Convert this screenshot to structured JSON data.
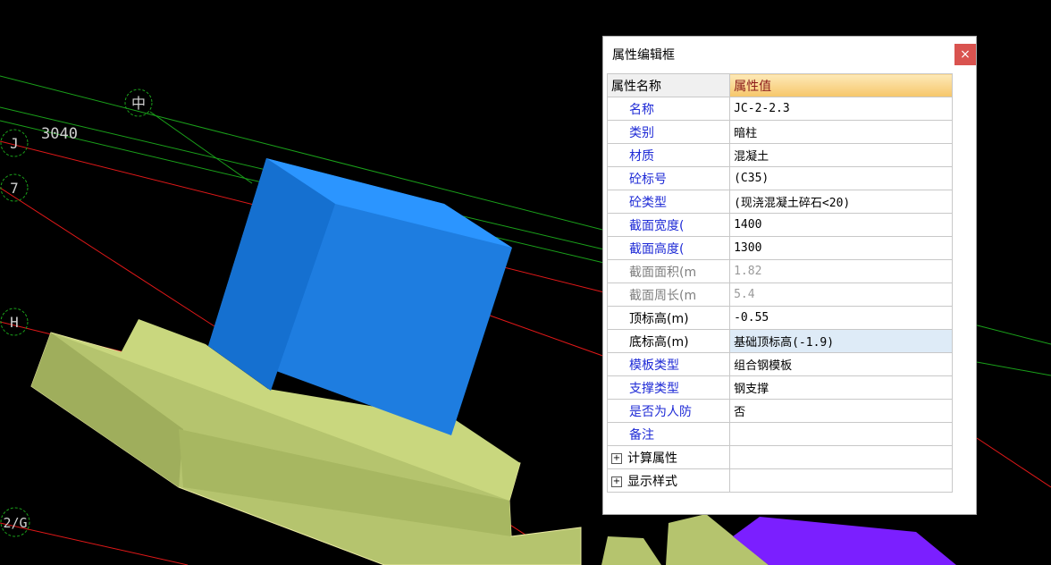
{
  "viewport": {
    "axis_labels": {
      "zhong": "中",
      "j": "J",
      "seven": "7",
      "h": "H",
      "two_g": "2/G"
    },
    "dimension_text": "3040",
    "colors": {
      "background": "#000000",
      "column": "#1e7de0",
      "foundation": "#b5c46e",
      "purple_element": "#7b1fff"
    }
  },
  "panel": {
    "title": "属性编辑框",
    "close_label": "×",
    "header": {
      "name": "属性名称",
      "value": "属性值"
    },
    "rows": [
      {
        "name": "名称",
        "value": "JC-2-2.3"
      },
      {
        "name": "类别",
        "value": "暗柱"
      },
      {
        "name": "材质",
        "value": "混凝土"
      },
      {
        "name": "砼标号",
        "value": "(C35)"
      },
      {
        "name": "砼类型",
        "value": "(现浇混凝土碎石<20)"
      },
      {
        "name": "截面宽度(",
        "value": "1400"
      },
      {
        "name": "截面高度(",
        "value": "1300"
      },
      {
        "name": "截面面积(m",
        "value": "1.82"
      },
      {
        "name": "截面周长(m",
        "value": "5.4"
      },
      {
        "name": "顶标高(m)",
        "value": "-0.55"
      },
      {
        "name": "底标高(m)",
        "value": "基础顶标高(-1.9)"
      },
      {
        "name": "模板类型",
        "value": "组合钢模板"
      },
      {
        "name": "支撑类型",
        "value": "钢支撑"
      },
      {
        "name": "是否为人防",
        "value": "否"
      },
      {
        "name": "备注",
        "value": ""
      }
    ],
    "groups": [
      {
        "expander": "+",
        "name": "计算属性"
      },
      {
        "expander": "+",
        "name": "显示样式"
      }
    ]
  }
}
